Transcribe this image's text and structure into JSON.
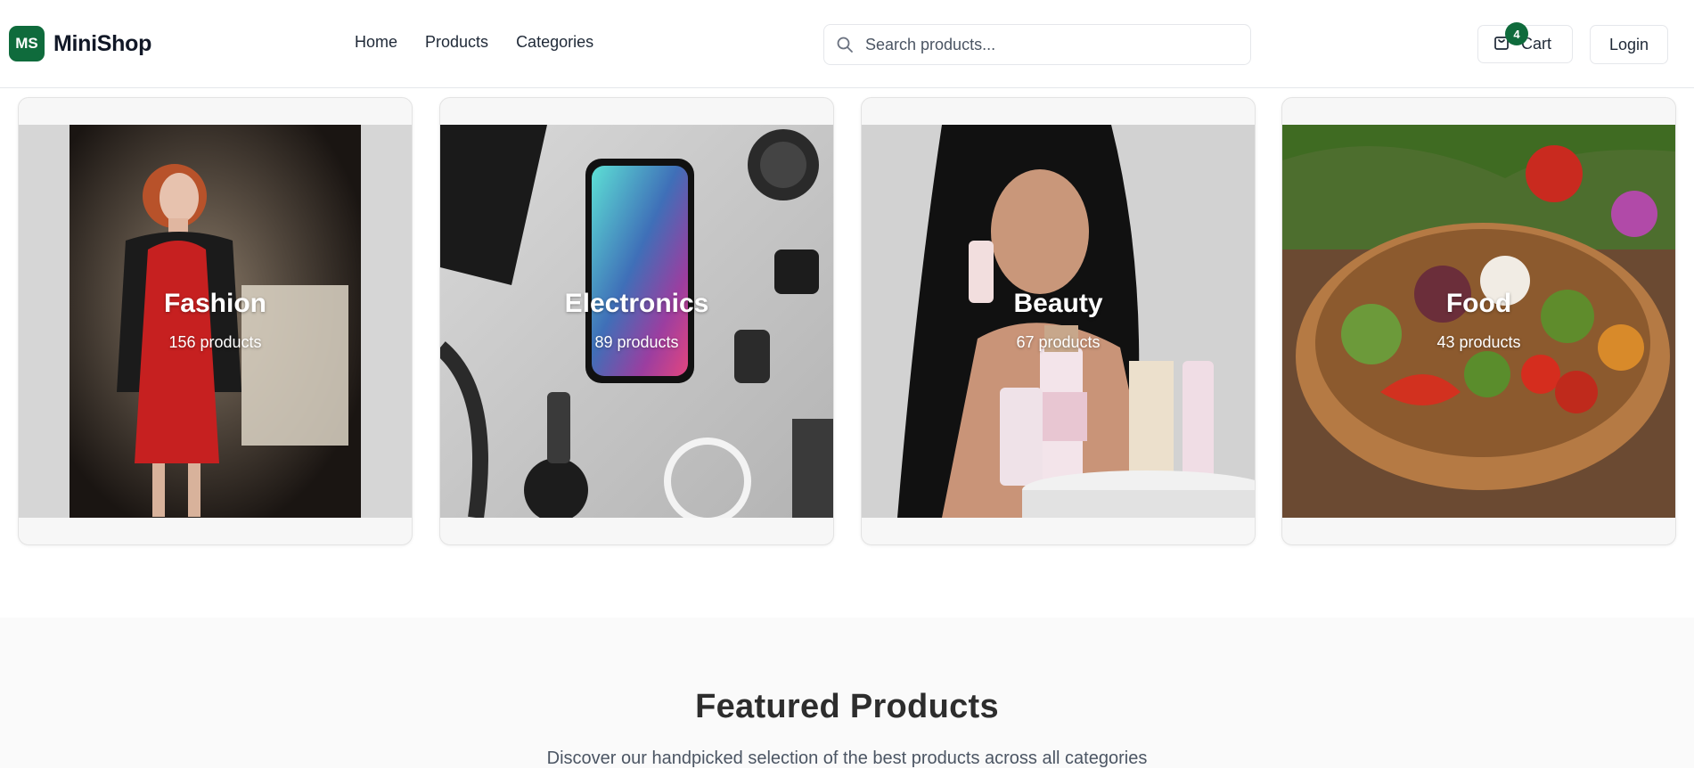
{
  "brand": {
    "badge": "MS",
    "name": "MiniShop"
  },
  "nav": {
    "items": [
      "Home",
      "Products",
      "Categories"
    ]
  },
  "search": {
    "placeholder": "Search products..."
  },
  "cart": {
    "label": "Cart",
    "count": "4"
  },
  "auth": {
    "login_label": "Login"
  },
  "categories": [
    {
      "name": "Fashion",
      "count_label": "156 products",
      "image": "woman-red-dress-leather-jacket"
    },
    {
      "name": "Electronics",
      "count_label": "89 products",
      "image": "smartphone-gadgets-flatlay"
    },
    {
      "name": "Beauty",
      "count_label": "67 products",
      "image": "woman-skincare-bottles"
    },
    {
      "name": "Food",
      "count_label": "43 products",
      "image": "vegetable-salad-bowl"
    }
  ],
  "featured": {
    "title": "Featured Products",
    "subtitle": "Discover our handpicked selection of the best products across all categories"
  },
  "colors": {
    "brand": "#0f6b3c",
    "border": "#e5e7eb",
    "section_bg": "#fafafa"
  }
}
